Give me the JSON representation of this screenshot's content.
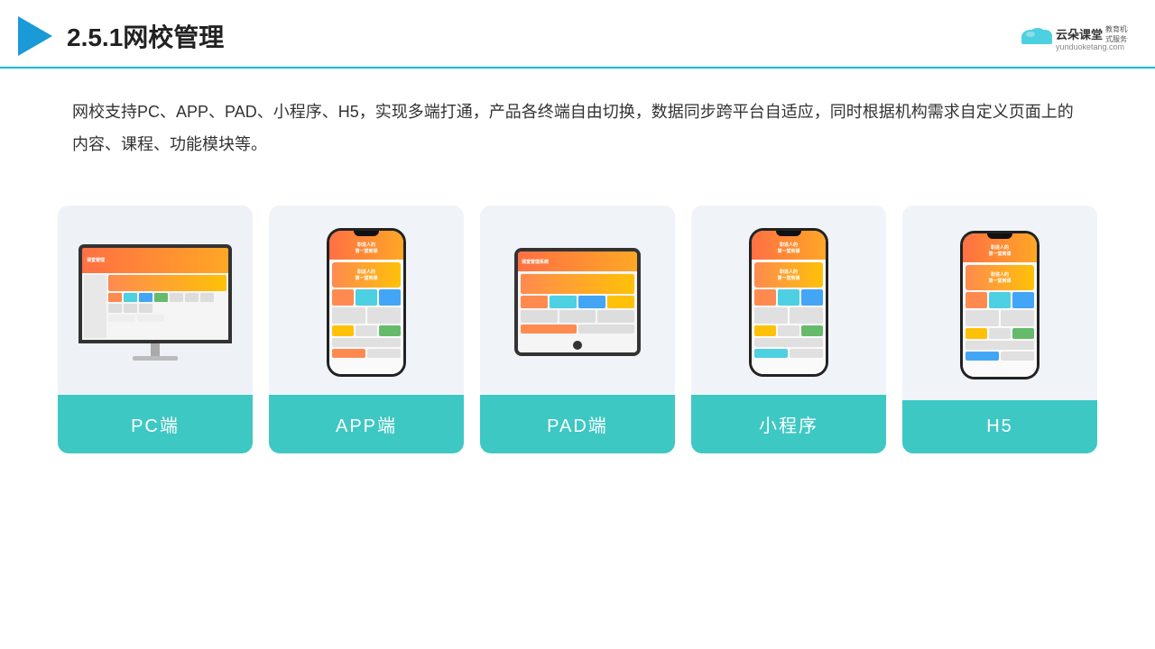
{
  "header": {
    "section_number": "2.5.1",
    "title": "网校管理",
    "logo_brand": "云朵课堂",
    "logo_url": "yunduoketang.com",
    "logo_tagline": "教育机构一站式服务云平台"
  },
  "description": {
    "text": "网校支持PC、APP、PAD、小程序、H5，实现多端打通，产品各终端自由切换，数据同步跨平台自适应，同时根据机构需求自定义页面上的内容、课程、功能模块等。"
  },
  "cards": [
    {
      "id": "pc",
      "label": "PC端",
      "device": "pc"
    },
    {
      "id": "app",
      "label": "APP端",
      "device": "phone"
    },
    {
      "id": "pad",
      "label": "PAD端",
      "device": "tablet"
    },
    {
      "id": "miniprogram",
      "label": "小程序",
      "device": "phone"
    },
    {
      "id": "h5",
      "label": "H5",
      "device": "phone"
    }
  ]
}
